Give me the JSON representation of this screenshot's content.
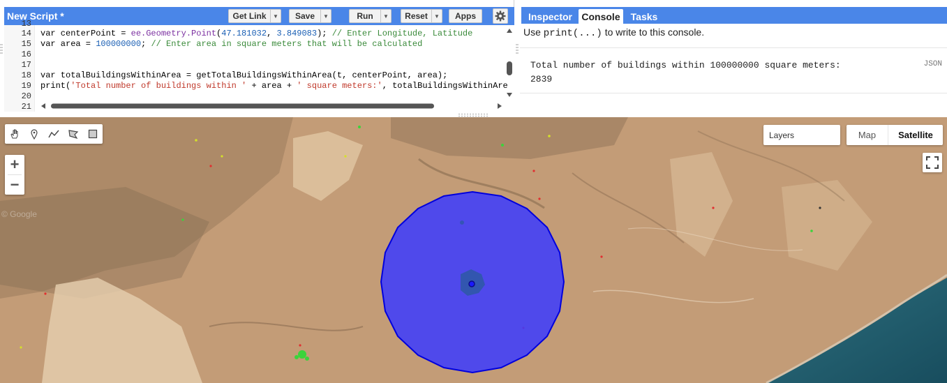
{
  "editor": {
    "title": "New Script *",
    "buttons": {
      "get_link": "Get Link",
      "save": "Save",
      "run": "Run",
      "reset": "Reset",
      "apps": "Apps"
    },
    "gutter_top": "13",
    "lines": [
      {
        "n": "14"
      },
      {
        "n": "15"
      },
      {
        "n": "16"
      },
      {
        "n": "17"
      },
      {
        "n": "18"
      },
      {
        "n": "19"
      },
      {
        "n": "20"
      },
      {
        "n": "21"
      }
    ],
    "code": {
      "l14": {
        "a": "var centerPoint = ",
        "b": "ee.Geometry.Point",
        "c": "(",
        "d": "47.181032",
        "e": ", ",
        "f": "3.849083",
        "g": "); ",
        "h": "// Enter Longitude, Latitude"
      },
      "l15": {
        "a": "var area = ",
        "b": "100000000",
        "c": "; ",
        "d": "// Enter area in square meters that will be calculated"
      },
      "l18": "var totalBuildingsWithinArea = getTotalBuildingsWithinArea(t, centerPoint, area);",
      "l19": {
        "a": "print(",
        "b": "'Total number of buildings within '",
        "c": " + area + ",
        "d": "' square meters:'",
        "e": ", totalBuildingsWithinAre"
      }
    }
  },
  "console": {
    "tabs": [
      "Inspector",
      "Console",
      "Tasks"
    ],
    "active_tab": "Console",
    "hint_prefix": "Use ",
    "hint_code": "print(...)",
    "hint_suffix": " to write to this console.",
    "output_line1": "Total number of buildings within 100000000 square meters:",
    "output_line2": "2839",
    "json_label": "JSON"
  },
  "map": {
    "layers_label": "Layers",
    "map_types": [
      "Map",
      "Satellite"
    ],
    "selected_map_type": "Satellite",
    "zoom_in": "+",
    "zoom_out": "−",
    "watermark": "© Google",
    "buffer_fill": "#3b3bff",
    "buffer_stroke": "#0000dd"
  },
  "colors": {
    "toolbar_blue": "#4a86e8"
  }
}
